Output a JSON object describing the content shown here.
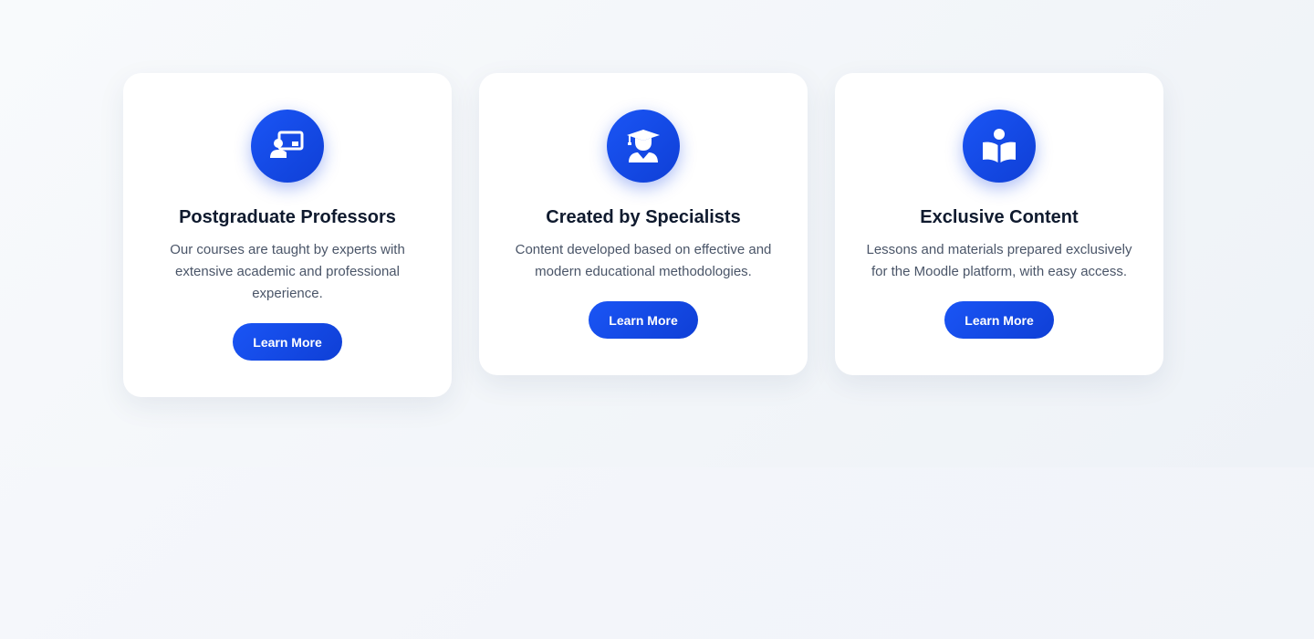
{
  "colors": {
    "accent": "#1a55f5",
    "accent_dark": "#0f3fd6",
    "title": "#0f1a2e",
    "body_text": "#4a5568",
    "card_bg": "#ffffff",
    "page_bg": "#f5f7fb"
  },
  "features": [
    {
      "icon": "teacher-board-icon",
      "title": "Postgraduate Professors",
      "description": "Our courses are taught by experts with extensive academic and professional experience.",
      "button_label": "Learn More"
    },
    {
      "icon": "graduate-icon",
      "title": "Created by Specialists",
      "description": "Content developed based on effective and modern educational methodologies.",
      "button_label": "Learn More"
    },
    {
      "icon": "book-reader-icon",
      "title": "Exclusive Content",
      "description": "Lessons and materials prepared exclusively for the Moodle platform, with easy access.",
      "button_label": "Learn More"
    }
  ]
}
